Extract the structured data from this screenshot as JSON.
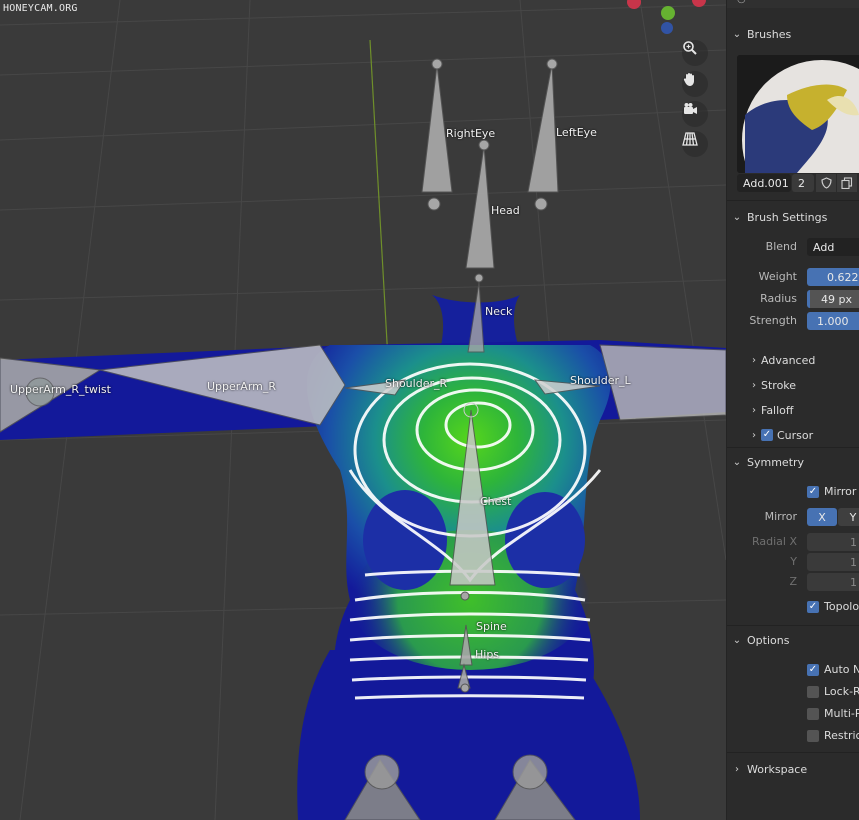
{
  "watermark": "HONEYCAM.ORG",
  "bones": {
    "right_eye": "RightEye",
    "left_eye": "LeftEye",
    "head": "Head",
    "neck": "Neck",
    "shoulder_r": "Shoulder_R",
    "shoulder_l": "Shoulder_L",
    "upper_arm_r": "UpperArm_R",
    "upper_arm_r_twist": "UpperArm_R_twist",
    "chest": "Chest",
    "spine": "Spine",
    "hips": "Hips"
  },
  "nav_icons": [
    "zoom-icon",
    "hand-pan-icon",
    "camera-icon",
    "grid-perspective-icon"
  ],
  "panel": {
    "brushes": {
      "header": "Brushes",
      "name": "Add.001",
      "users": "2"
    },
    "brush_settings": {
      "header": "Brush Settings",
      "blend_label": "Blend",
      "blend_value": "Add",
      "weight_label": "Weight",
      "weight_value": "0.622",
      "weight_fraction": 0.622,
      "radius_label": "Radius",
      "radius_value": "49 px",
      "strength_label": "Strength",
      "strength_value": "1.000",
      "advanced": "Advanced",
      "stroke": "Stroke",
      "falloff": "Falloff",
      "cursor": "Cursor"
    },
    "symmetry": {
      "header": "Symmetry",
      "mirror_vertex": "Mirror V",
      "mirror_label": "Mirror",
      "x": "X",
      "y": "Y",
      "radial_x_label": "Radial X",
      "radial_y_label": "Y",
      "radial_z_label": "Z",
      "radial_x": "1",
      "radial_y": "1",
      "radial_z": "1",
      "topology": "Topolog"
    },
    "options": {
      "header": "Options",
      "auto_normalize": "Auto No",
      "lock_relative": "Lock-Re",
      "multi_paint": "Multi-Pa",
      "restrict": "Restrict"
    },
    "workspace": {
      "header": "Workspace"
    }
  },
  "colors": {
    "panel_bg": "#2b2b2b",
    "accent_blue": "#4772b3",
    "mesh_blue": "#13199a",
    "weight_green": "#3fc21c"
  }
}
